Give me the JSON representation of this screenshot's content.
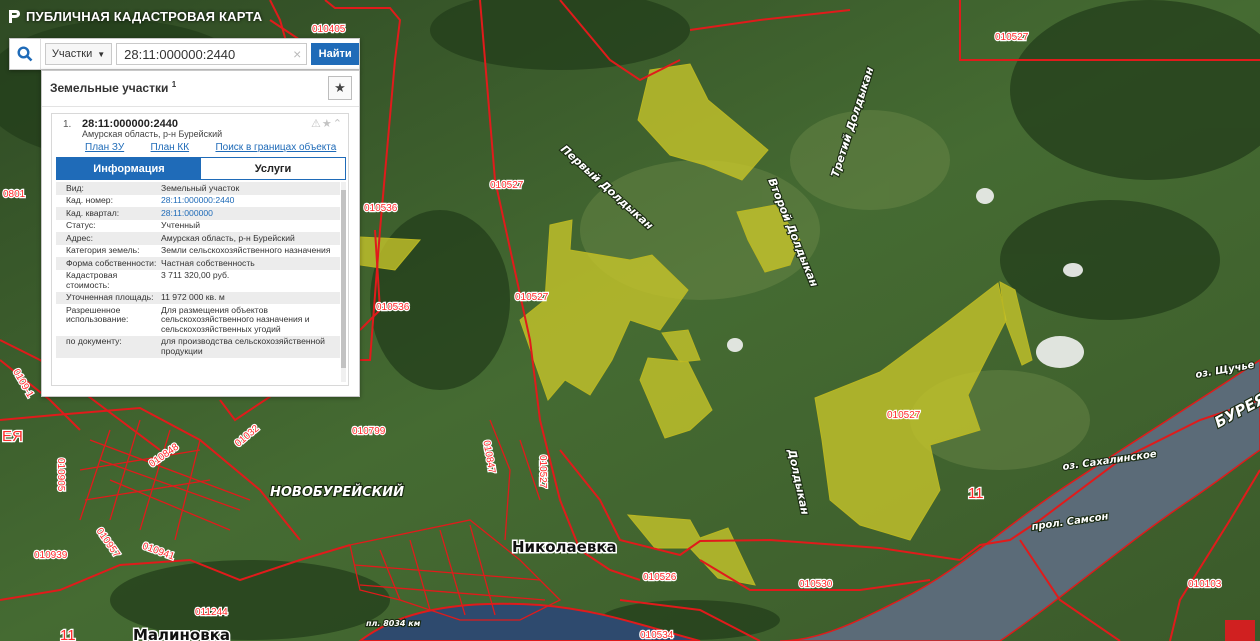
{
  "app": {
    "title": "ПУБЛИЧНАЯ КАДАСТРОВАЯ КАРТА"
  },
  "search": {
    "category": "Участки",
    "query": "28:11:000000:2440",
    "find_label": "Найти"
  },
  "panel": {
    "title": "Земельные участки",
    "count_sup": "1",
    "record": {
      "index": "1.",
      "number": "28:11:000000:2440",
      "address": "Амурская область, р-н Бурейский",
      "actions": "⚠★⌃",
      "links": [
        "План ЗУ →",
        "План КК →",
        "Поиск в границах объекта →"
      ],
      "tabs": [
        "Информация",
        "Услуги"
      ],
      "info": [
        {
          "k": "Вид:",
          "v": "Земельный участок"
        },
        {
          "k": "Кад. номер:",
          "v": "28:11:000000:2440"
        },
        {
          "k": "Кад. квартал:",
          "v": "28:11:000000"
        },
        {
          "k": "Статус:",
          "v": "Учтенный"
        },
        {
          "k": "Адрес:",
          "v": "Амурская область, р-н Бурейский"
        },
        {
          "k": "Категория земель:",
          "v": "Земли сельскохозяйственного назначения"
        },
        {
          "k": "Форма собственности:",
          "v": "Частная собственность"
        },
        {
          "k": "Кадастровая стоимость:",
          "v": "3 711 320,00 руб."
        },
        {
          "k": "Уточненная площадь:",
          "v": "11 972 000 кв. м"
        },
        {
          "k": "Разрешенное использование:",
          "v": "Для размещения объектов сельскохозяйственного назначения и сельскохозяйственных угодий"
        },
        {
          "k": "по документу:",
          "v": "для производства сельскохозяйственной продукции"
        }
      ]
    }
  },
  "map": {
    "colors": {
      "boundary": "#e01b1b",
      "parcel": "#c9c62a",
      "river": "#5b6b78",
      "water": "#2e4a6e"
    },
    "cad_labels": [
      "010405",
      "010527",
      "010527",
      "010536",
      "010536",
      "0801",
      "010527",
      "010527",
      "010799",
      "010848",
      "010847",
      "010905",
      "01032",
      "010939",
      "010957",
      "010941",
      "011244",
      "010526",
      "010530",
      "010534",
      "010103",
      "010527",
      "0109-1",
      "ЕЯ",
      "11",
      "11"
    ],
    "place_labels": [
      "Первый Долдыкан",
      "Второй Долдыкан",
      "Третий Долдыкан",
      "Долдыкан",
      "НОВОБУРЕЙСКИЙ",
      "Николаевка",
      "Малиновка",
      "БУРЕЯ",
      "оз. Щучье",
      "оз. Сахалинское",
      "прол. Самсон",
      "пл. 8034 км"
    ]
  }
}
